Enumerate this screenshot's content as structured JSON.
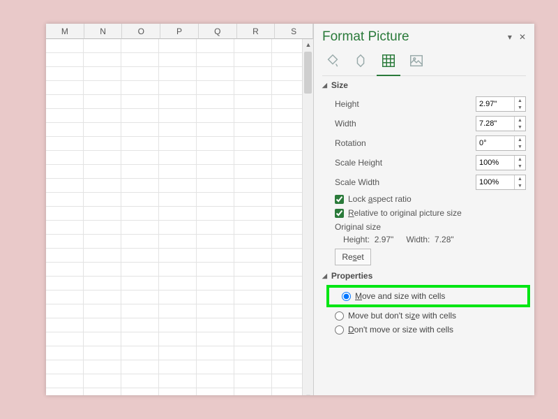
{
  "sheet": {
    "columns": [
      "M",
      "N",
      "O",
      "P",
      "Q",
      "R",
      "S"
    ]
  },
  "panel": {
    "title": "Format Picture",
    "dropdown_glyph": "▾",
    "close_glyph": "✕",
    "sections": {
      "size": {
        "label": "Size",
        "height_label": "Height",
        "height_value": "2.97\"",
        "width_label": "Width",
        "width_value": "7.28\"",
        "rotation_label": "Rotation",
        "rotation_value": "0°",
        "scale_h_label": "Scale Height",
        "scale_h_value": "100%",
        "scale_w_label": "Scale Width",
        "scale_w_value": "100%",
        "lock_label_pre": "Lock ",
        "lock_label_u": "a",
        "lock_label_post": "spect ratio",
        "rel_label_pre": "",
        "rel_label_u": "R",
        "rel_label_post": "elative to original picture size",
        "original_label": "Original size",
        "orig_h_label": "Height:",
        "orig_h_value": "2.97\"",
        "orig_w_label": "Width:",
        "orig_w_value": "7.28\"",
        "reset_label_pre": "Re",
        "reset_label_u": "s",
        "reset_label_post": "et"
      },
      "props": {
        "label": "Properties",
        "opt1_pre": "",
        "opt1_u": "M",
        "opt1_post": "ove and size with cells",
        "opt2_pre": "Move but don't si",
        "opt2_u": "z",
        "opt2_post": "e with cells",
        "opt3_pre": "",
        "opt3_u": "D",
        "opt3_post": "on't move or size with cells"
      }
    }
  }
}
